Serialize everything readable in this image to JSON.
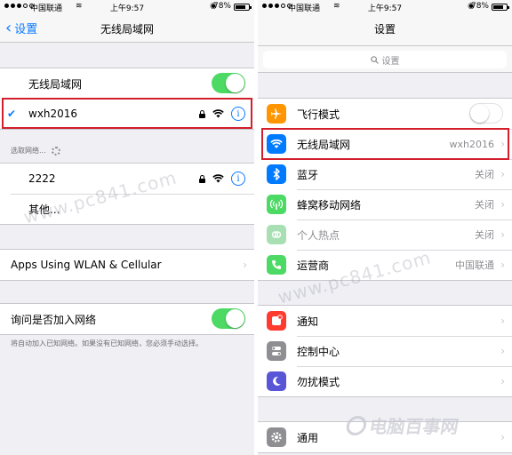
{
  "status_bar": {
    "carrier": "中国联通",
    "time": "上午9:57",
    "battery": "78%"
  },
  "left": {
    "back_label": "设置",
    "title": "无线局域网",
    "wlan_label": "无线局域网",
    "wlan_on": true,
    "connected_network": "wxh2016",
    "choose_network_label": "选取网络...",
    "networks": [
      {
        "name": "2222"
      },
      {
        "name": "其他..."
      }
    ],
    "apps_label": "Apps Using WLAN & Cellular",
    "ask_join_label": "询问是否加入网络",
    "ask_join_on": true,
    "ask_join_note": "将自动加入已知网络。如果没有已知网络，您必须手动选择。"
  },
  "right": {
    "title": "设置",
    "search_placeholder": "设置",
    "group1": [
      {
        "label": "飞行模式",
        "value": "",
        "icon": "airplane-icon",
        "color": "#ff9500",
        "toggle": "off"
      },
      {
        "label": "无线局域网",
        "value": "wxh2016",
        "icon": "wifi-icon",
        "color": "#007aff"
      },
      {
        "label": "蓝牙",
        "value": "关闭",
        "icon": "bluetooth-icon",
        "color": "#007aff"
      },
      {
        "label": "蜂窝移动网络",
        "value": "关闭",
        "icon": "cellular-icon",
        "color": "#4cd964"
      },
      {
        "label": "个人热点",
        "value": "关闭",
        "icon": "hotspot-icon",
        "color": "#a8e0b4",
        "dimmed": true
      },
      {
        "label": "运营商",
        "value": "中国联通",
        "icon": "phone-icon",
        "color": "#4cd964"
      }
    ],
    "group2": [
      {
        "label": "通知",
        "icon": "notifications-icon",
        "color": "#ff3b30"
      },
      {
        "label": "控制中心",
        "icon": "control-center-icon",
        "color": "#8e8e93"
      },
      {
        "label": "勿扰模式",
        "icon": "moon-icon",
        "color": "#5856d6"
      }
    ],
    "group3": [
      {
        "label": "通用",
        "icon": "gear-icon",
        "color": "#8e8e93"
      }
    ]
  },
  "watermarks": [
    "www.pc841.com",
    "www.pc841.com"
  ],
  "logo_text": "电脑百事网"
}
